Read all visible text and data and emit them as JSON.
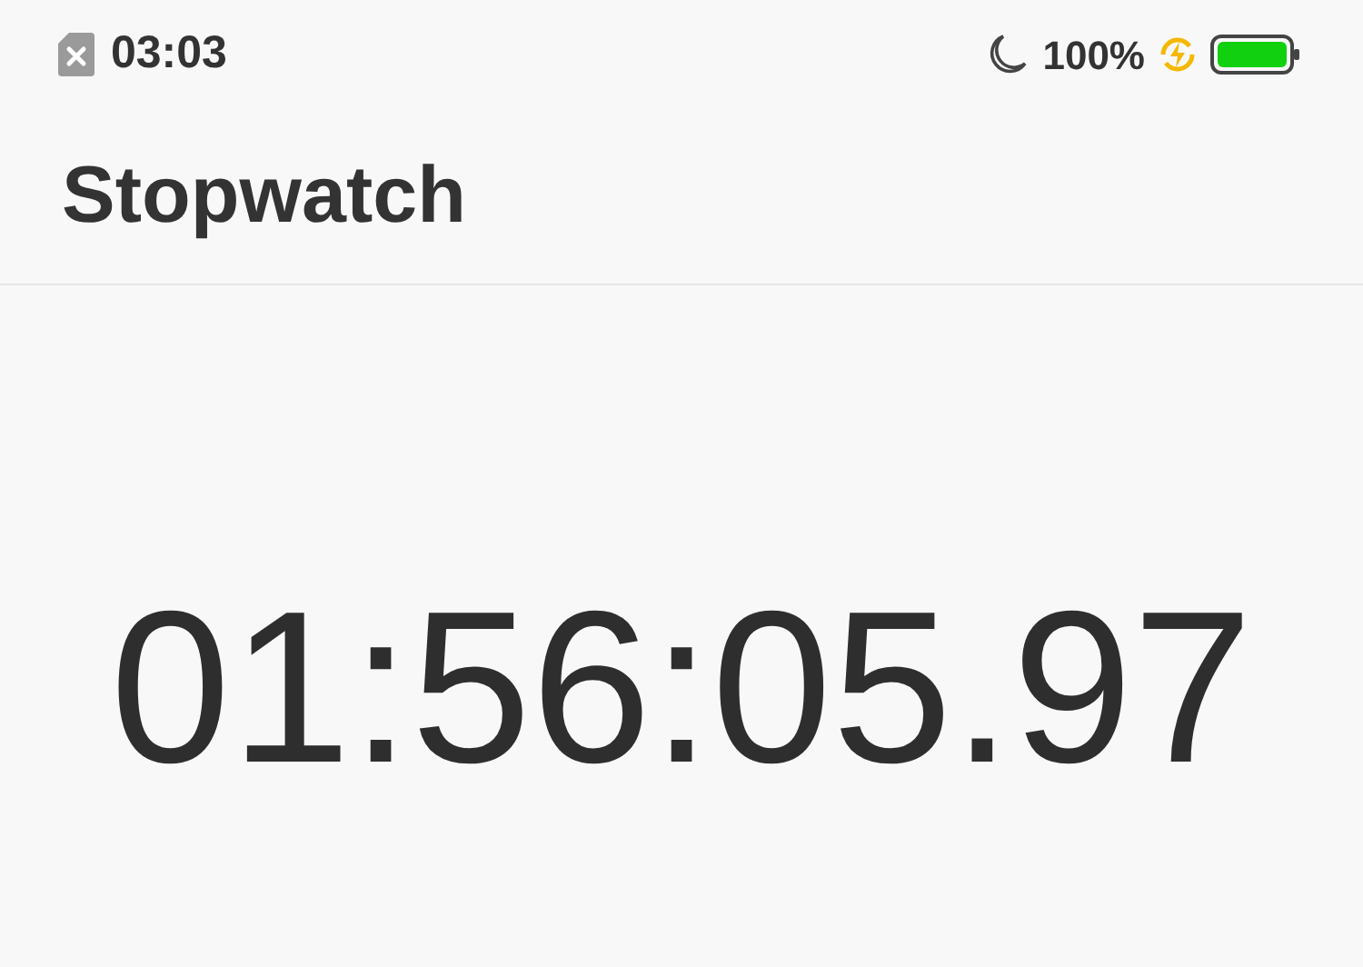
{
  "status_bar": {
    "time": "03:03",
    "battery_percent": "100%"
  },
  "header": {
    "title": "Stopwatch"
  },
  "stopwatch": {
    "elapsed": "01:56:05.97"
  }
}
